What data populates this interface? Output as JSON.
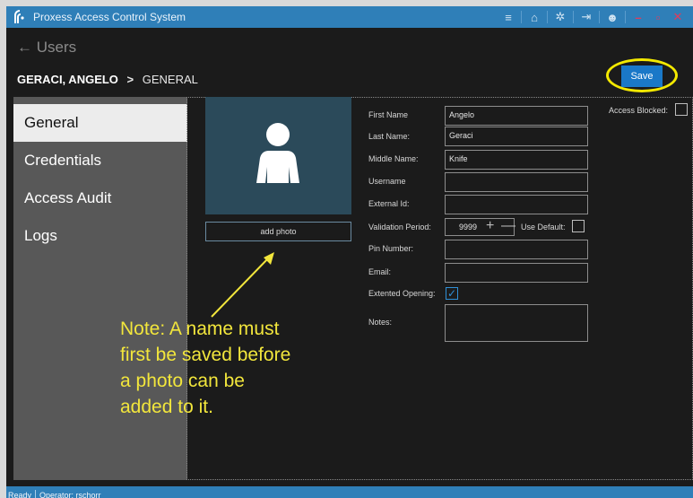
{
  "app": {
    "title": "Proxess Access Control System"
  },
  "titlebar_icons": [
    "menu-icon",
    "home-icon",
    "gear-icon",
    "logout-icon",
    "user-icon",
    "minimize-icon",
    "maximize-icon",
    "close-icon"
  ],
  "header": {
    "back_label": "Users",
    "back_arrow": "←",
    "breadcrumb_name": "GERACI, ANGELO",
    "breadcrumb_sep": ">",
    "breadcrumb_section": "GENERAL"
  },
  "toolbar": {
    "save_label": "Save"
  },
  "sidebar": {
    "items": [
      {
        "label": "General",
        "active": true
      },
      {
        "label": "Credentials",
        "active": false
      },
      {
        "label": "Access Audit",
        "active": false
      },
      {
        "label": "Logs",
        "active": false
      }
    ]
  },
  "photo": {
    "add_label": "add photo"
  },
  "form": {
    "first_name": {
      "label": "First Name",
      "value": "Angelo"
    },
    "last_name": {
      "label": "Last Name:",
      "value": "Geraci"
    },
    "middle_name": {
      "label": "Middle Name:",
      "value": "Knife"
    },
    "username": {
      "label": "Username",
      "value": ""
    },
    "external_id": {
      "label": "External Id:",
      "value": ""
    },
    "validation_period": {
      "label": "Validation Period:",
      "value": "9999",
      "use_default_label": "Use Default:",
      "use_default_checked": false
    },
    "pin_number": {
      "label": "Pin Number:",
      "value": ""
    },
    "email": {
      "label": "Email:",
      "value": ""
    },
    "extended_opening": {
      "label": "Extented Opening:",
      "checked": true
    },
    "notes": {
      "label": "Notes:",
      "value": ""
    },
    "access_blocked": {
      "label": "Access Blocked:",
      "checked": false
    }
  },
  "annotation": {
    "note_lines": [
      "Note: A name must",
      "first be saved before",
      "a photo can be",
      "added to it."
    ],
    "color": "#f2e63c"
  },
  "status": {
    "state": "Ready",
    "operator": "Operator: rschorr"
  },
  "colors": {
    "accent": "#2f7fb8",
    "save_button": "#1a78c8",
    "highlight": "#f4e900"
  }
}
